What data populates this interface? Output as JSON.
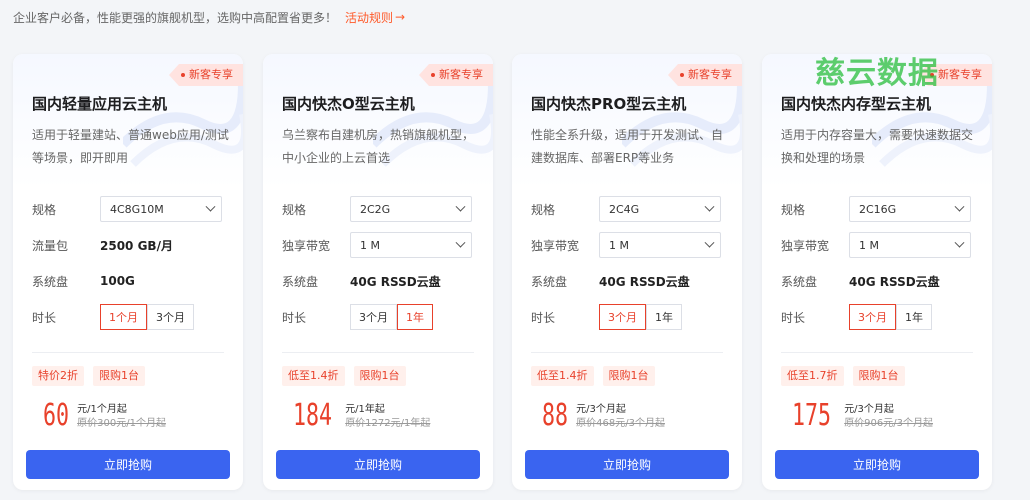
{
  "topbar": {
    "text": "企业客户必备，性能更强的旗舰机型，选购中高配置省更多！",
    "link": "活动规则",
    "link_arrow": "→"
  },
  "labels": {
    "spec": "规格",
    "traffic": "流量包",
    "bandwidth": "独享带宽",
    "disk": "系统盘",
    "duration": "时长"
  },
  "buy_label": "立即抢购",
  "watermark": "慈云数据",
  "cards": [
    {
      "tag": "新客专享",
      "title": "国内轻量应用云主机",
      "desc": "适用于轻量建站、普通web应用/测试等场景，即开即用",
      "spec": "4C8G10M",
      "second_value": "2500 GB/月",
      "disk": "100G",
      "durations": [
        "1个月",
        "3个月"
      ],
      "selected_duration": "1个月",
      "badge1": "特价2折",
      "badge2": "限购1台",
      "price": "60",
      "unit": "元/1个月起",
      "original": "原价300元/1个月起"
    },
    {
      "tag": "新客专享",
      "title": "国内快杰O型云主机",
      "desc": "乌兰察布自建机房，热销旗舰机型，中小企业的上云首选",
      "spec": "2C2G",
      "second_value": "1 M",
      "disk": "40G RSSD云盘",
      "durations": [
        "3个月",
        "1年"
      ],
      "selected_duration": "1年",
      "badge1": "低至1.4折",
      "badge2": "限购1台",
      "price": "184",
      "unit": "元/1年起",
      "original": "原价1272元/1年起"
    },
    {
      "tag": "新客专享",
      "title": "国内快杰PRO型云主机",
      "desc": "性能全系升级，适用于开发测试、自建数据库、部署ERP等业务",
      "spec": "2C4G",
      "second_value": "1 M",
      "disk": "40G RSSD云盘",
      "durations": [
        "3个月",
        "1年"
      ],
      "selected_duration": "3个月",
      "badge1": "低至1.4折",
      "badge2": "限购1台",
      "price": "88",
      "unit": "元/3个月起",
      "original": "原价468元/3个月起"
    },
    {
      "tag": "新客专享",
      "title": "国内快杰内存型云主机",
      "desc": "适用于内存容量大，需要快速数据交换和处理的场景",
      "spec": "2C16G",
      "second_value": "1 M",
      "disk": "40G RSSD云盘",
      "durations": [
        "3个月",
        "1年"
      ],
      "selected_duration": "3个月",
      "badge1": "低至1.7折",
      "badge2": "限购1台",
      "price": "175",
      "unit": "元/3个月起",
      "original": "原价906元/3个月起"
    }
  ]
}
